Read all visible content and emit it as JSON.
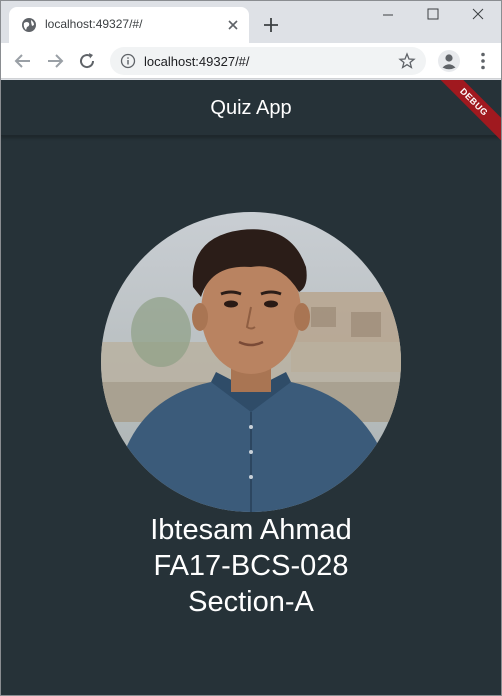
{
  "browser": {
    "tab_title": "localhost:49327/#/",
    "url": "localhost:49327/#/",
    "icons": {
      "favicon": "globe-icon",
      "tab_close": "close-icon",
      "new_tab": "plus-icon",
      "minimize": "minimize-icon",
      "maximize": "maximize-icon",
      "close_window": "close-icon",
      "back": "arrow-left-icon",
      "forward": "arrow-right-icon",
      "reload": "reload-icon",
      "site_info": "info-icon",
      "bookmark": "star-icon",
      "profile": "person-icon",
      "menu": "vertical-dots-icon"
    }
  },
  "app": {
    "title": "Quiz App",
    "debug_banner": "DEBUG",
    "colors": {
      "background": "#263238",
      "banner": "#a0191f",
      "text": "#ffffff"
    },
    "profile": {
      "name": "Ibtesam Ahmad",
      "reg_no": "FA17-BCS-028",
      "section": "Section-A"
    }
  }
}
